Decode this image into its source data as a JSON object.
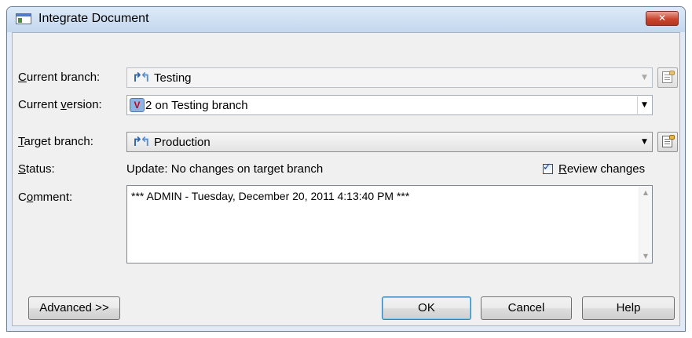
{
  "dialog": {
    "title": "Integrate Document",
    "close_glyph": "✕"
  },
  "current_branch": {
    "label_access_key": "C",
    "label_rest": "urrent branch:",
    "icon": "branch-icon",
    "value": "Testing"
  },
  "current_version": {
    "label_before": "Current ",
    "label_access_key": "v",
    "label_after": "ersion:",
    "icon": "version-icon",
    "icon_glyph": "V",
    "value": "2 on Testing branch"
  },
  "target_branch": {
    "label_access_key": "T",
    "label_rest": "arget branch:",
    "icon": "branch-icon",
    "value": "Production"
  },
  "status": {
    "label_access_key": "S",
    "label_rest": "tatus:",
    "value": "Update: No changes on target branch"
  },
  "review_changes": {
    "checked": true,
    "check_glyph": "✓",
    "label_access_key": "R",
    "label_rest": "eview changes"
  },
  "comment": {
    "label_before": "C",
    "label_access_key": "o",
    "label_after": "mment:",
    "text": "*** ADMIN - Tuesday, December 20, 2011 4:13:40 PM ***"
  },
  "glyphs": {
    "dropdown": "▼",
    "scroll_up": "▲",
    "scroll_down": "▼",
    "branch": "↱↰"
  },
  "buttons": {
    "advanced": "Advanced >>",
    "ok": "OK",
    "cancel": "Cancel",
    "help": "Help"
  }
}
